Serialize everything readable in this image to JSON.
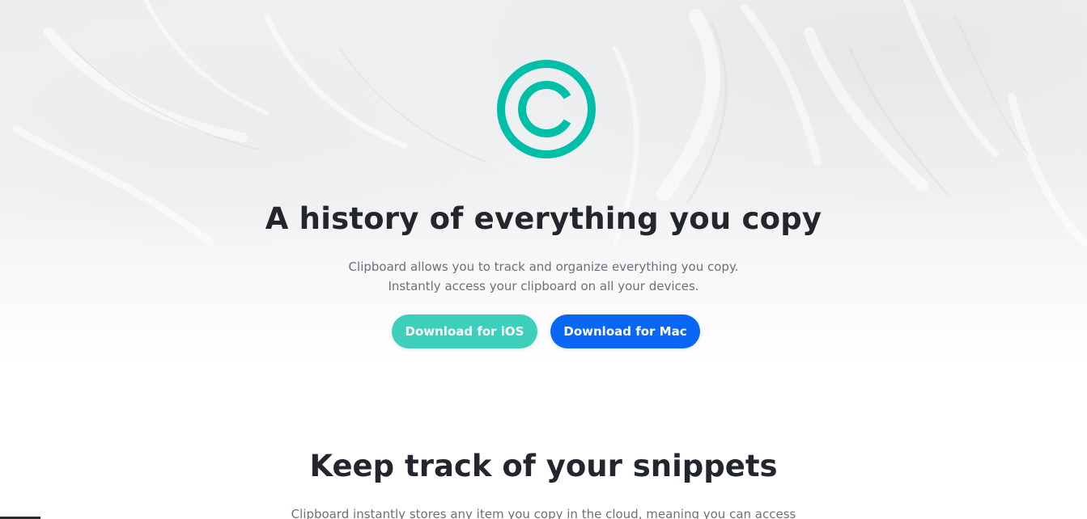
{
  "hero": {
    "logo_icon": "copyright-c-icon",
    "accent_color": "#00bfa8",
    "title": "A history of everything you copy",
    "subtitle_line1": "Clipboard allows you to track and organize everything you copy.",
    "subtitle_line2": "Instantly access your clipboard on all your devices.",
    "buttons": {
      "ios_label": "Download for iOS",
      "ios_color": "#3ccfbb",
      "mac_label": "Download for Mac",
      "mac_color": "#0a66f5"
    }
  },
  "snippets_section": {
    "title": "Keep track of your snippets",
    "text": "Clipboard instantly stores any item you copy in the cloud, meaning you can access"
  }
}
